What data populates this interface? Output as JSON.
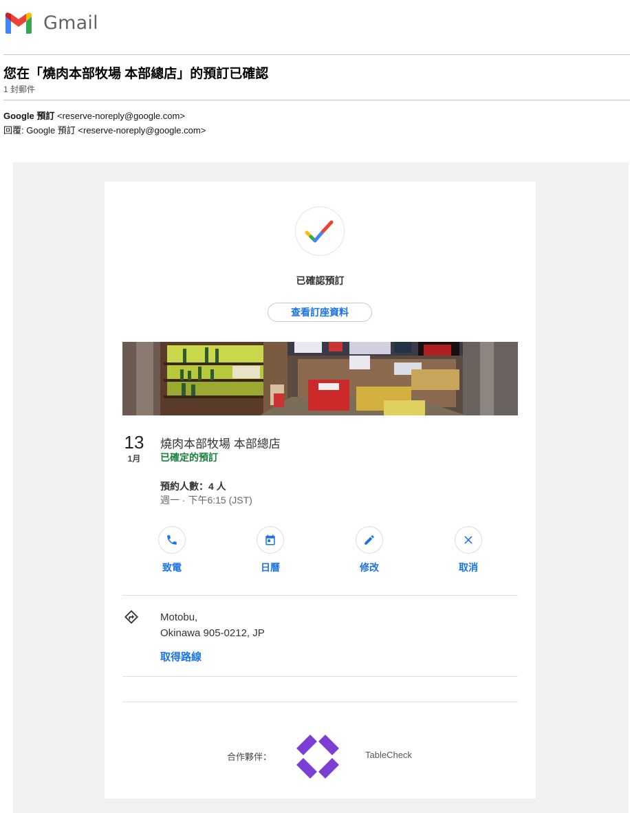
{
  "app": {
    "name": "Gmail"
  },
  "email": {
    "subject": "您在「燒肉本部牧場 本部總店」的預訂已確認",
    "message_count": "1 封郵件",
    "from_name": "Google 預訂",
    "from_email": "<reserve-noreply@google.com>",
    "reply_to_label": "回覆:",
    "reply_to": "Google 預訂 <reserve-noreply@google.com>"
  },
  "reservation": {
    "status_heading": "已確認預訂",
    "view_button_label": "查看訂座資料",
    "day": "13",
    "month": "1月",
    "restaurant_name": "燒肉本部牧場 本部總店",
    "status": "已確定的預訂",
    "party_size": "預約人數：4 人",
    "datetime": "週一 · 下午6:15 (JST)",
    "status_color": "#188038"
  },
  "actions": [
    {
      "label": "致電",
      "icon": "phone-icon"
    },
    {
      "label": "日曆",
      "icon": "calendar-icon"
    },
    {
      "label": "修改",
      "icon": "pencil-icon"
    },
    {
      "label": "取消",
      "icon": "close-icon"
    }
  ],
  "location": {
    "address_line1": "Motobu,",
    "address_line2": "Okinawa 905-0212, JP",
    "directions_label": "取得路線"
  },
  "partner": {
    "label": "合作夥伴：",
    "name": "TableCheck"
  },
  "colors": {
    "link": "#1a73e8",
    "partner_logo": "#7b3fd6"
  }
}
